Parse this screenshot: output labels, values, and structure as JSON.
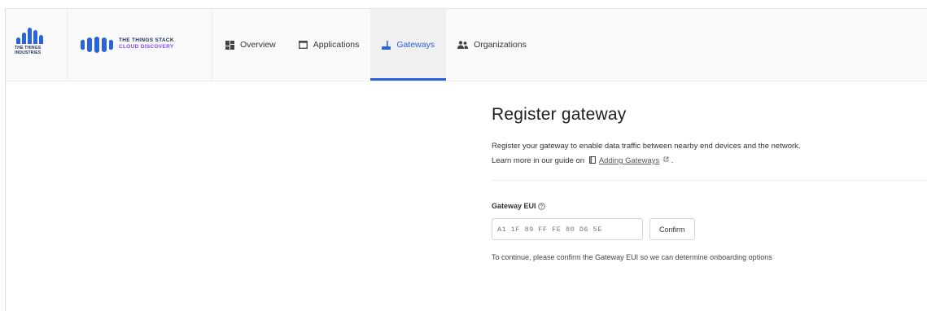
{
  "branding": {
    "company_name": "THE THINGS INDUSTRIES",
    "product_name": "THE THINGS STACK",
    "product_edition": "CLOUD DISCOVERY",
    "brand_blue": "#2b63d9",
    "brand_purple": "#8a3ffc"
  },
  "nav": {
    "items": [
      {
        "label": "Overview",
        "icon": "dashboard-icon",
        "active": false
      },
      {
        "label": "Applications",
        "icon": "window-icon",
        "active": false
      },
      {
        "label": "Gateways",
        "icon": "gateway-icon",
        "active": true
      },
      {
        "label": "Organizations",
        "icon": "people-icon",
        "active": false
      }
    ]
  },
  "page": {
    "title": "Register gateway",
    "description_line1": "Register your gateway to enable data traffic between nearby end devices and the network.",
    "description_prefix": "Learn more in our guide on",
    "guide_link": "Adding Gateways",
    "description_suffix": "."
  },
  "form": {
    "eui_label": "Gateway EUI",
    "eui_placeholder": "A1 1F 89 FF FE 80 D6 5E",
    "confirm_label": "Confirm",
    "hint": "To continue, please confirm the Gateway EUI so we can determine onboarding options"
  }
}
